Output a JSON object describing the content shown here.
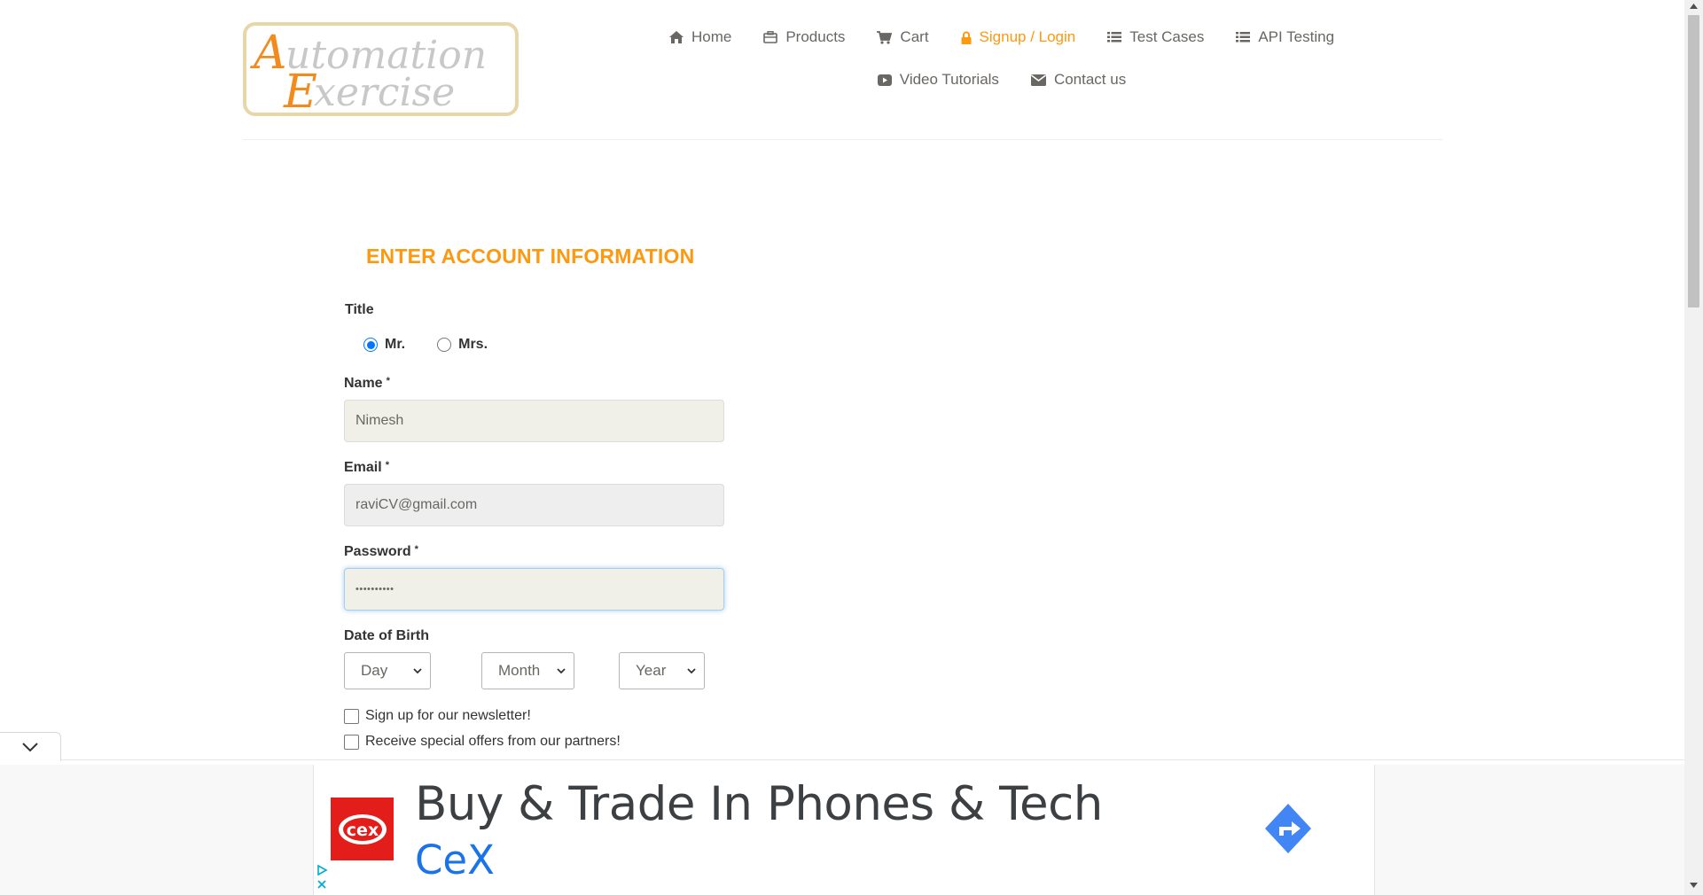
{
  "header": {
    "logo_text": "Automation Exercise",
    "nav": {
      "home": "Home",
      "products": "Products",
      "cart": "Cart",
      "signup_login": "Signup / Login",
      "test_cases": "Test Cases",
      "api_testing": "API Testing",
      "video_tutorials": "Video Tutorials",
      "contact_us": "Contact us"
    },
    "active_item": "signup_login",
    "accent_color": "#FE980F"
  },
  "form": {
    "heading": "ENTER ACCOUNT INFORMATION",
    "title_label": "Title",
    "title_options": [
      "Mr.",
      "Mrs."
    ],
    "title_selected": "Mr.",
    "name_label": "Name",
    "name_value": "Nimesh",
    "email_label": "Email",
    "email_value": "raviCV@gmail.com",
    "password_label": "Password",
    "password_value": "••••••••••",
    "required_mark": "*",
    "dob_label": "Date of Birth",
    "dob": {
      "day": "Day",
      "month": "Month",
      "year": "Year"
    },
    "newsletter_label": "Sign up for our newsletter!",
    "newsletter_checked": false,
    "offers_label": "Receive special offers from our partners!",
    "offers_checked": false
  },
  "ad": {
    "headline": "Buy & Trade In Phones & Tech",
    "advertiser": "CeX",
    "logo_text": "cex",
    "brand_color": "#e31d1a",
    "link_color": "#1a73e8"
  },
  "icons": [
    "home-icon",
    "briefcase-icon",
    "cart-icon",
    "lock-icon",
    "list-icon",
    "play-icon",
    "envelope-icon",
    "chevron-down-icon",
    "directions-icon",
    "ad-info-icon",
    "close-icon"
  ]
}
